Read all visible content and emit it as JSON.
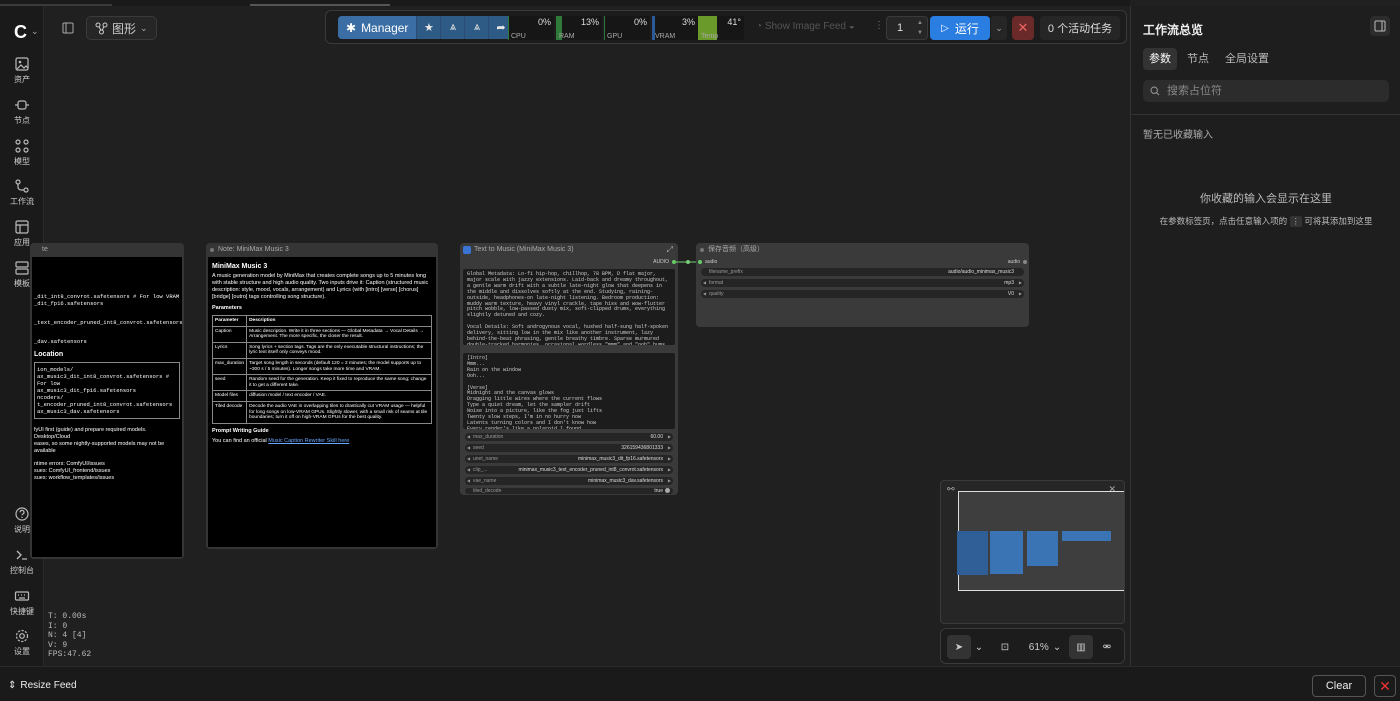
{
  "sidebar": {
    "logo": "C",
    "items": [
      {
        "icon": "image-icon",
        "label": "资产"
      },
      {
        "icon": "node-icon",
        "label": "节点"
      },
      {
        "icon": "model-icon",
        "label": "模型"
      },
      {
        "icon": "workflow-icon",
        "label": "工作流"
      },
      {
        "icon": "app-icon",
        "label": "应用"
      },
      {
        "icon": "template-icon",
        "label": "模板"
      }
    ],
    "bottom_items": [
      {
        "icon": "help-icon",
        "label": "说明"
      },
      {
        "icon": "console-icon",
        "label": "控制台"
      },
      {
        "icon": "keyboard-icon",
        "label": "快捷键"
      },
      {
        "icon": "gear-icon",
        "label": "设置"
      }
    ]
  },
  "stats": {
    "t": "T: 0.00s",
    "i": "I: 0",
    "n": "N: 4 [4]",
    "v": "V: 9",
    "fps": "FPS:47.62"
  },
  "toolbar": {
    "graph_label": "图形"
  },
  "control_bar": {
    "manager_label": "Manager",
    "meters": [
      {
        "name": "CPU",
        "value": "0%",
        "level": 0.0,
        "color": "#2f7a3a"
      },
      {
        "name": "RAM",
        "value": "13%",
        "level": 0.13,
        "color": "#2f7a3a"
      },
      {
        "name": "GPU",
        "value": "0%",
        "level": 0.0,
        "color": "#2f7a3a"
      },
      {
        "name": "VRAM",
        "value": "3%",
        "level": 0.03,
        "color": "#2a5a9a"
      },
      {
        "name": "Temp",
        "value": "41°",
        "level": 0.41,
        "color": "#6a9a2a"
      }
    ],
    "show_image_feed": "Show Image Feed",
    "queue_count": "1",
    "run_label": "运行",
    "active_tasks": "0 个活动任务"
  },
  "nodes": {
    "partial": {
      "title": "te",
      "lines": [
        "_dit_int8_convrot.safetensors # For low VRAM",
        "_dit_fp16.safetensors",
        "_text_encoder_pruned_int8_convrot.safetensors",
        "_dav.safetensors",
        "Location",
        "ion_models/",
        "ax_music3_dit_int8_convrot.safetensors # For low",
        "",
        "ax_music3_dit_fp16.safetensors",
        "ncoders/",
        "",
        "t_encoder_pruned_int8_convrot.safetensors",
        "",
        "ax_music3_dav.safetensors",
        "",
        "fyUI first (guide) and prepare required models. Desktop/Cloud",
        "eases, so some nightly-supported models may not be available",
        "",
        "ntime errors: ComfyUI/issues",
        "sues: ComfyUI_frontend/issues",
        "sues: workflow_templates/issues"
      ]
    },
    "note": {
      "title": "Note: MiniMax Music 3",
      "heading": "MiniMax Music 3",
      "intro": "A music generation model by MiniMax that creates complete songs up to 5 minutes long with stable structure and high audio quality. Two inputs drive it: Caption (structured music description: style, mood, vocals, arrangement) and Lyrics (with [intro] [verse] [chorus] [bridge] [outro] tags controlling song structure).",
      "params_heading": "Parameters",
      "table_header": [
        "Parameter",
        "Description"
      ],
      "table_rows": [
        [
          "Caption",
          "Music description. Write it in three sections — Global Metadata → Vocal Details → Arrangement. The more specific, the closer the result."
        ],
        [
          "Lyrics",
          "Song lyrics + section tags. Tags are the only executable structural instructions; the lyric text itself only conveys mood."
        ],
        [
          "max_duration",
          "Target song length in seconds (default 120 = 2 minutes; the model supports up to ~300 s / 5 minutes). Longer songs take more time and VRAM."
        ],
        [
          "seed",
          "Random seed for the generation. Keep it fixed to reproduce the same song; change it to get a different take."
        ],
        [
          "Model files",
          "diffusion model / text encoder / VAE."
        ],
        [
          "Tiled decode",
          "Decode the audio VAE in overlapping tiles to drastically cut VRAM usage — helpful for long songs on low-VRAM GPUs. Slightly slower, with a small risk of seams at tile boundaries; turn it off on high-VRAM GPUs for the best quality."
        ]
      ],
      "guide_heading": "Prompt Writing Guide",
      "guide_text": "You can find an official ",
      "guide_link": "Music Caption Rewriter Skill here"
    },
    "t2m": {
      "title": "Text to Music (MiniMax Music 3)",
      "output_label": "AUDIO",
      "caption_text": "Global Metadata: Lo-fi hip-hop, chillhop, 78 BPM, D flat major, major scale with jazzy extensions. Laid-back and dreamy throughout, a gentle warm drift with a subtle late-night glow that deepens in the middle and dissolves softly at the end. Studying, raining-outside, headphones-on late-night listening. Bedroom production: muddy warm texture, heavy vinyl crackle, tape hiss and wow-flutter pitch wobble, low-passed dusty mix, soft-clipped drums, everything slightly detuned and cozy.\n\nVocal Details: Soft androgynous vocal, hushed half-sung half-spoken delivery, sitting low in the mix like another instrument, lazy behind-the-beat phrasing, gentle breathy timbre. Sparse murmured double-tracked harmonies, occasional wordless \"mmm\" and \"ooh\" hums drenched in tape delay and warm spring reverb. Long stretches with no vocals at all.",
      "lyrics_text": "[Intro]\nMmm...\nRain on the window\nOoh...\n\n[Verse]\nMidnight and the canvas glows\nDragging little wires where the current flows\nType a quiet dream, let the sampler drift\nNoise into a picture, like the fog just lifts\nTwenty slow steps, I'm in no hurry now\nLatents turning colors and I don't know how\nEvery render's like a polaroid I found\nSoft focus memories, no sound",
      "widgets": [
        {
          "name": "max_duration",
          "value": "60.00"
        },
        {
          "name": "seed",
          "value": "326159436801333"
        },
        {
          "name": "unet_name",
          "value": "minimax_music3_dit_fp16.safetensors"
        },
        {
          "name": "clip_...",
          "value": "minimax_music3_text_encoder_pruned_int8_convrot.safetensors"
        },
        {
          "name": "vae_name",
          "value": "minimax_music3_dav.safetensors"
        },
        {
          "name": "tiled_decode",
          "value": "true"
        }
      ]
    },
    "save": {
      "title": "保存音频（高级）",
      "input_label": "audio",
      "output_label": "audio",
      "widgets": [
        {
          "name": "filename_prefix",
          "value": "audio/audio_minimax_music3"
        },
        {
          "name": "format",
          "value": "mp3"
        },
        {
          "name": "quality",
          "value": "V0"
        }
      ]
    }
  },
  "canvas_tools": {
    "zoom": "61%"
  },
  "right_panel": {
    "title": "工作流总览",
    "tabs": [
      "参数",
      "节点",
      "全局设置"
    ],
    "search_placeholder": "搜索占位符",
    "empty_label": "暂无已收藏输入",
    "msg_title": "你收藏的输入会显示在这里",
    "msg_body_a": "在参数标签页，点击任意输入项的",
    "msg_body_b": "可将其添加到这里"
  },
  "bottom_bar": {
    "resize_feed": "Resize Feed",
    "clear": "Clear"
  },
  "colors": {
    "accent": "#2a7de1",
    "manager": "#3a6ea5",
    "danger": "#e33333"
  }
}
